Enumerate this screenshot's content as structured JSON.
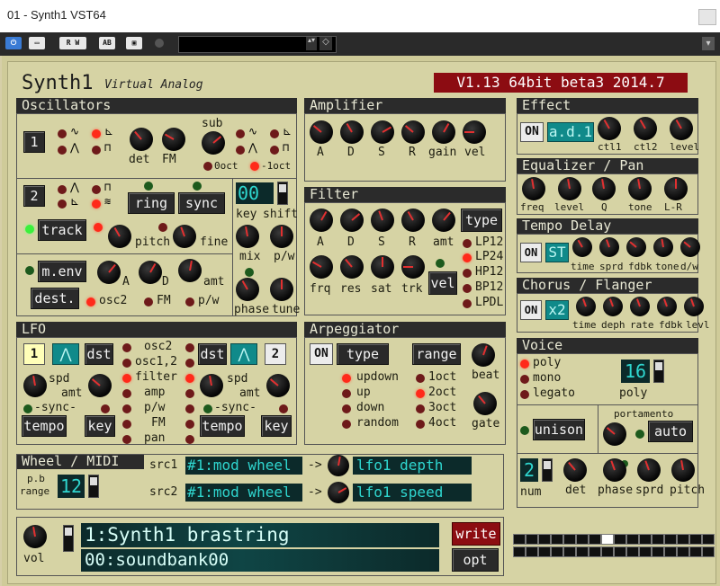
{
  "window": {
    "title": "01 - Synth1 VST64"
  },
  "host": {
    "buttons": [
      "⏻",
      "▭",
      "R W",
      "AB",
      "▣"
    ],
    "preset_selector": "",
    "arrows": "▴▾"
  },
  "header": {
    "brand": "Synth1",
    "subtitle": "Virtual Analog",
    "version": "V1.13 64bit beta3 2014.7"
  },
  "osc": {
    "title": "Oscillators",
    "osc1_button": "1",
    "osc2_button": "2",
    "det": "det",
    "fm": "FM",
    "sub": "sub",
    "oct0": "0oct",
    "oct1": "-1oct",
    "ring": "ring",
    "sync": "sync",
    "track": "track",
    "pitch": "pitch",
    "fine": "fine",
    "tune_value": "00",
    "key": "key",
    "shift": "shift",
    "mix": "mix",
    "pw": "p/w",
    "phase": "phase",
    "tune": "tune",
    "menv": "m.env",
    "dest": "dest.",
    "a": "A",
    "d": "D",
    "amt": "amt",
    "osc2": "osc2",
    "fm2": "FM",
    "pw2": "p/w"
  },
  "amp": {
    "title": "Amplifier",
    "labels": [
      "A",
      "D",
      "S",
      "R",
      "gain",
      "vel"
    ]
  },
  "filter": {
    "title": "Filter",
    "labels": [
      "A",
      "D",
      "S",
      "R",
      "amt"
    ],
    "type": "type",
    "types": [
      "LP12",
      "LP24",
      "HP12",
      "BP12",
      "LPDL"
    ],
    "bottom": [
      "frq",
      "res",
      "sat",
      "trk"
    ],
    "vel": "vel"
  },
  "effect": {
    "title": "Effect",
    "on": "ON",
    "type": "a.d.1",
    "labels": [
      "ctl1",
      "ctl2",
      "level"
    ]
  },
  "eq": {
    "title": "Equalizer / Pan",
    "labels": [
      "freq",
      "level",
      "Q",
      "tone",
      "L-R"
    ]
  },
  "delay": {
    "title": "Tempo Delay",
    "on": "ON",
    "mode": "ST",
    "labels": [
      "time",
      "sprd",
      "fdbk",
      "tone",
      "d/w"
    ]
  },
  "chorus": {
    "title": "Chorus / Flanger",
    "on": "ON",
    "mode": "x2",
    "labels": [
      "time",
      "deph",
      "rate",
      "fdbk",
      "levl"
    ]
  },
  "lfo": {
    "title": "LFO",
    "lfo1": "1",
    "lfo2": "2",
    "dst": "dst",
    "spd": "spd",
    "amt": "amt",
    "sync": "-sync-",
    "tempo": "tempo",
    "key": "key",
    "dests": [
      "osc2",
      "osc1,2",
      "filter",
      "amp",
      "p/w",
      "FM",
      "pan"
    ]
  },
  "arp": {
    "title": "Arpeggiator",
    "on": "ON",
    "type": "type",
    "range": "range",
    "types": [
      "updown",
      "up",
      "down",
      "random"
    ],
    "ranges": [
      "1oct",
      "2oct",
      "3oct",
      "4oct"
    ],
    "beat": "beat",
    "gate": "gate"
  },
  "voice": {
    "title": "Voice",
    "modes": [
      "poly",
      "mono",
      "legato"
    ],
    "poly_value": "16",
    "poly": "poly",
    "unison": "unison",
    "portamento": "portamento",
    "auto": "auto",
    "num_value": "2",
    "num": "num",
    "det": "det",
    "phase": "phase",
    "sprd": "sprd",
    "pitch": "pitch"
  },
  "wheel": {
    "title": "Wheel / MIDI",
    "pb": "p.b",
    "range": "range",
    "range_value": "12",
    "src1": "src1",
    "src1_value": "#1:mod wheel",
    "dst1_value": "lfo1 depth",
    "src2": "src2",
    "src2_value": "#1:mod wheel",
    "dst2_value": "lfo1 speed",
    "arrow": "->"
  },
  "bottom": {
    "vol": "vol",
    "patch": "1:Synth1 brastring",
    "bank": "00:soundbank00",
    "write": "write",
    "opt": "opt"
  },
  "colors": {
    "accent_red": "#ff2a1a",
    "lcd_teal": "#2fd6cf",
    "panel": "#d6d3a4",
    "header_red": "#8c0c12"
  }
}
